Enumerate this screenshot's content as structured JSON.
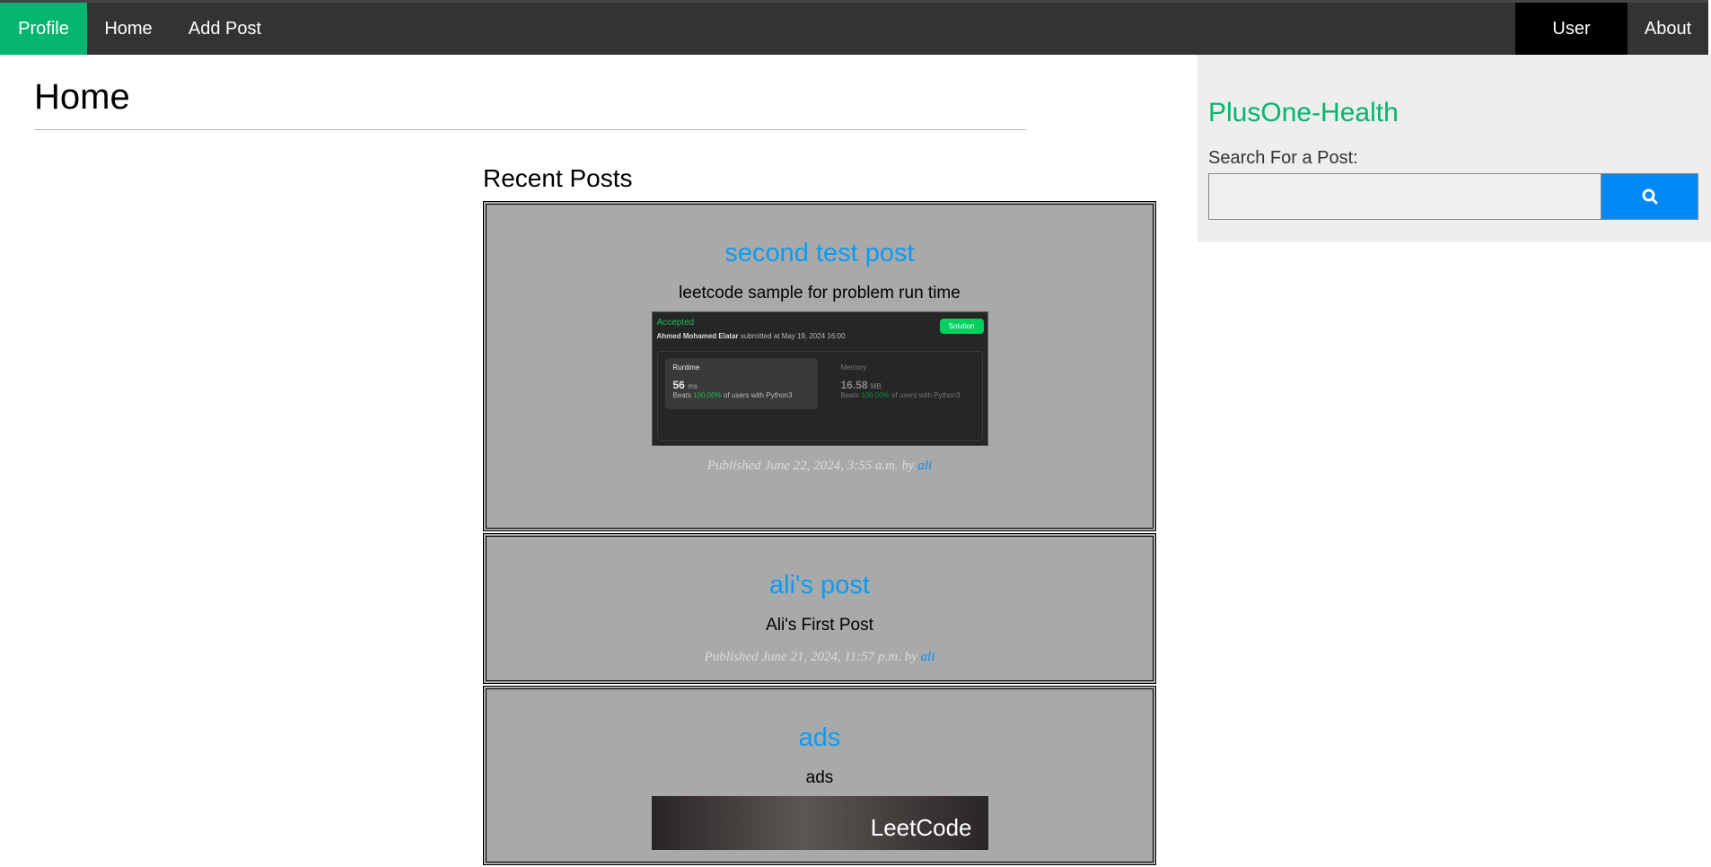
{
  "nav": {
    "profile": "Profile",
    "home": "Home",
    "add_post": "Add Post",
    "user": "User",
    "about": "About"
  },
  "page": {
    "title": "Home",
    "recent": "Recent Posts"
  },
  "sidebar": {
    "brand": "PlusOne-Health",
    "search_label": "Search For a Post:",
    "search_value": "",
    "search_icon": "search-icon"
  },
  "colors": {
    "accent": "#04b56f",
    "link": "#0a9cf5",
    "button": "#0088f5"
  },
  "posts": [
    {
      "title": "second test post",
      "description": "leetcode sample for problem run time",
      "published": "Published June 22, 2024, 3:55 a.m. by",
      "author": "ali",
      "image": {
        "status": "Accepted",
        "submitter": "Ahmed Mohamed Elatar",
        "submitted": "submitted at May 19, 2024 16:00",
        "solution": "Solution",
        "runtime_label": "Runtime",
        "runtime": "56",
        "runtime_unit": "ms",
        "memory_label": "Memory",
        "memory": "16.58",
        "memory_unit": "MB",
        "beats_prefix": "Beats",
        "beats": "100.00%",
        "beats_suffix": "of users with Python3"
      }
    },
    {
      "title": "ali's post",
      "description": "Ali's First Post",
      "published": "Published June 21, 2024, 11:57 p.m. by",
      "author": "ali"
    },
    {
      "title": "ads",
      "description": "ads",
      "image_text": "LeetCode"
    }
  ]
}
